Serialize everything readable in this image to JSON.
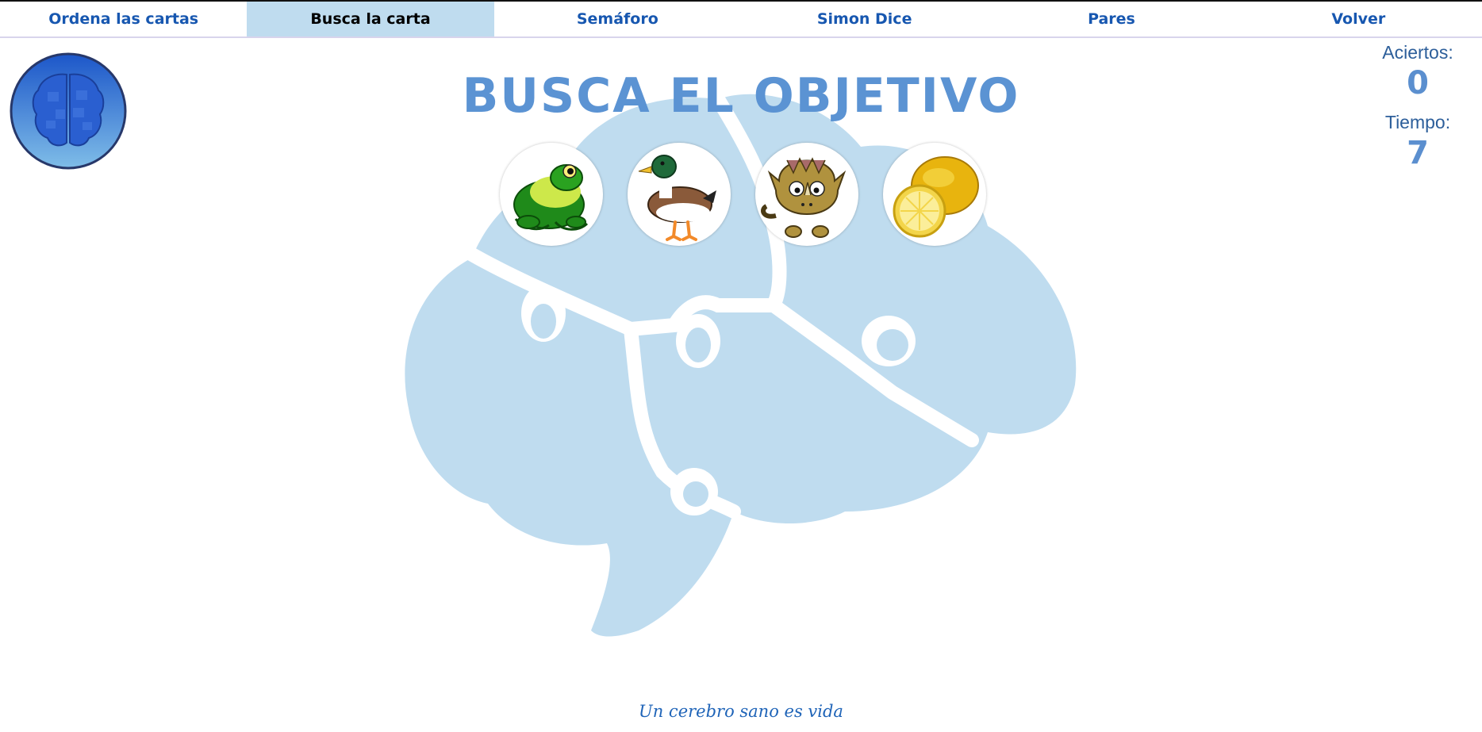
{
  "nav": {
    "items": [
      {
        "label": "Ordena las cartas",
        "active": false
      },
      {
        "label": "Busca la carta",
        "active": true
      },
      {
        "label": "Semáforo",
        "active": false
      },
      {
        "label": "Simon Dice",
        "active": false
      },
      {
        "label": "Pares",
        "active": false
      },
      {
        "label": "Volver",
        "active": false
      }
    ]
  },
  "game": {
    "title": "BUSCA EL OBJETIVO",
    "cards": [
      {
        "icon": "frog-icon"
      },
      {
        "icon": "duck-icon"
      },
      {
        "icon": "triceratops-icon"
      },
      {
        "icon": "lemon-icon"
      }
    ]
  },
  "stats": {
    "hits_label": "Aciertos:",
    "hits_value": "0",
    "time_label": "Tiempo:",
    "time_value": "7"
  },
  "footer": {
    "tagline": "Un cerebro sano es vida"
  },
  "colors": {
    "nav_text": "#1757b0",
    "nav_active_bg": "#bfdcef",
    "brain_bg": "#bfdcef",
    "title": "#5b93d3",
    "stat_value": "#5b8fcf"
  }
}
